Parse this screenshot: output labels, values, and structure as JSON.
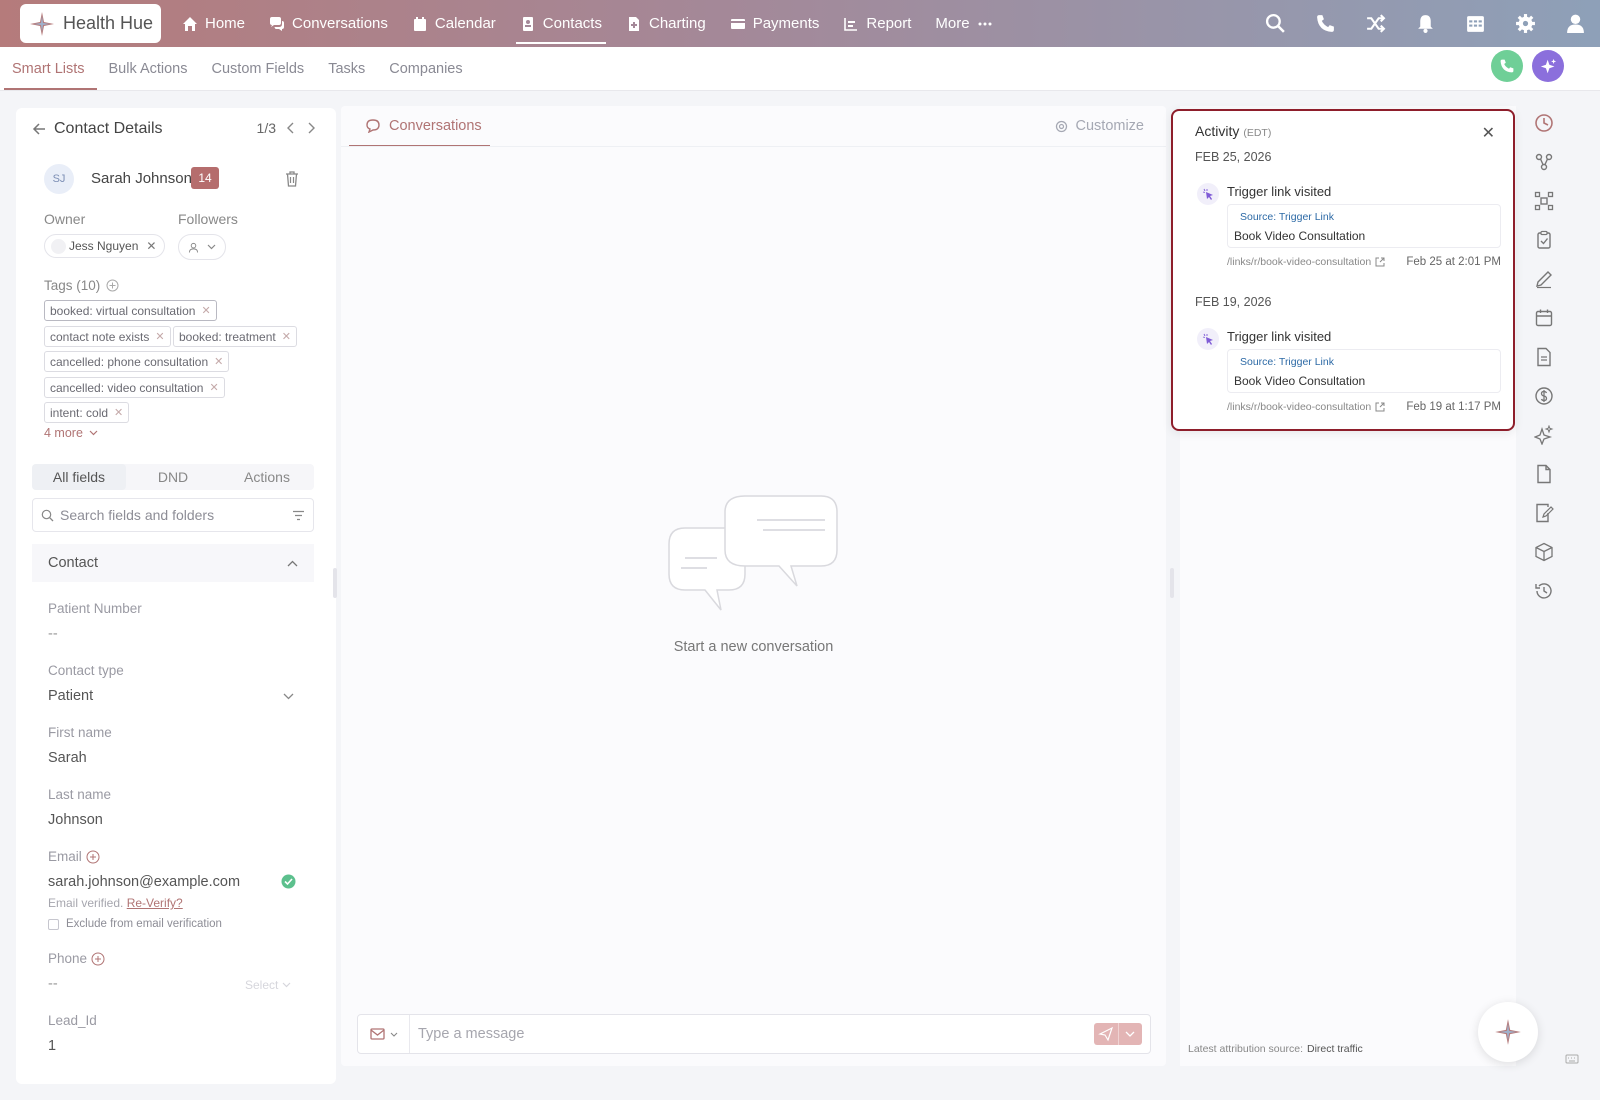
{
  "app": {
    "name": "Health Hue"
  },
  "nav": [
    {
      "label": "Home",
      "icon": "home-icon"
    },
    {
      "label": "Conversations",
      "icon": "chat-icon"
    },
    {
      "label": "Calendar",
      "icon": "calendar-icon"
    },
    {
      "label": "Contacts",
      "icon": "contact-icon",
      "active": true
    },
    {
      "label": "Charting",
      "icon": "chart-doc-icon"
    },
    {
      "label": "Payments",
      "icon": "card-icon"
    },
    {
      "label": "Report",
      "icon": "report-icon"
    },
    {
      "label": "More",
      "icon": "ellipsis-icon"
    }
  ],
  "subnav": [
    "Smart Lists",
    "Bulk Actions",
    "Custom Fields",
    "Tasks",
    "Companies"
  ],
  "contact_details": {
    "title": "Contact Details",
    "pager": "1/3",
    "initials": "SJ",
    "name": "Sarah Johnson",
    "count": "14",
    "owner_label": "Owner",
    "followers_label": "Followers",
    "owner": "Jess Nguyen",
    "tags_label": "Tags (10)",
    "tags": [
      "booked: virtual consultation",
      "contact note exists",
      "booked: treatment",
      "cancelled: phone consultation",
      "cancelled: video consultation",
      "intent: cold"
    ],
    "more": "4 more",
    "field_tabs": [
      "All fields",
      "DND",
      "Actions"
    ],
    "search_placeholder": "Search fields and folders",
    "section": "Contact",
    "fields": {
      "patient_number_label": "Patient Number",
      "patient_number": "--",
      "contact_type_label": "Contact type",
      "contact_type": "Patient",
      "first_name_label": "First name",
      "first_name": "Sarah",
      "last_name_label": "Last name",
      "last_name": "Johnson",
      "email_label": "Email",
      "email": "sarah.johnson@example.com",
      "email_verified": "Email verified.",
      "reverify": "Re-Verify?",
      "exclude": "Exclude from email verification",
      "phone_label": "Phone",
      "phone": "--",
      "phone_select": "Select",
      "lead_id_label": "Lead_Id",
      "lead_id": "1"
    }
  },
  "conversation": {
    "tab": "Conversations",
    "customize": "Customize",
    "empty": "Start a new conversation",
    "placeholder": "Type a message"
  },
  "activity": {
    "title": "Activity",
    "tz": "(EDT)",
    "groups": [
      {
        "date": "FEB 25, 2026",
        "event": "Trigger link visited",
        "source": "Source: Trigger Link",
        "name": "Book Video Consultation",
        "link": "/links/r/book-video-consultation",
        "time": "Feb 25 at 2:01 PM"
      },
      {
        "date": "FEB 19, 2026",
        "event": "Trigger link visited",
        "source": "Source: Trigger Link",
        "name": "Book Video Consultation",
        "link": "/links/r/book-video-consultation",
        "time": "Feb 19 at 1:17 PM"
      }
    ]
  },
  "attribution": {
    "label": "Latest attribution source:",
    "value": "Direct traffic"
  },
  "colors": {
    "accent": "#b07474",
    "activity_border": "#8e1e2b",
    "badge": "#b56d6d"
  }
}
